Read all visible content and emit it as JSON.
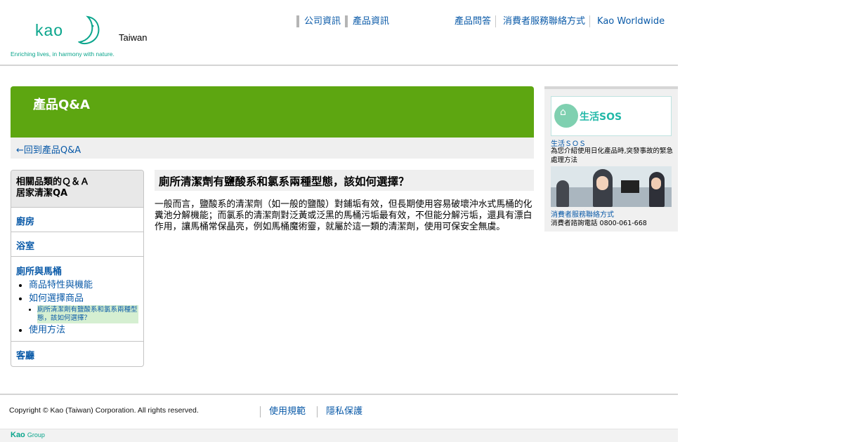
{
  "header": {
    "logo_text": "kao",
    "tagline": "Enriching lives, in harmony with nature.",
    "region": "Taiwan",
    "nav_primary": [
      "公司資訊",
      "產品資訊"
    ],
    "nav_secondary": [
      "產品問答",
      "消費者服務聯絡方式",
      "Kao Worldwide"
    ]
  },
  "banner": {
    "title": "產品Q&A",
    "back_link": "←回到產品Q&A"
  },
  "menu": {
    "heading_line1": "相關品類的Ｑ＆Ａ",
    "heading_line2": "居家清潔QA",
    "sections": [
      {
        "label": "廚房"
      },
      {
        "label": "浴室"
      },
      {
        "label": "廁所與馬桶",
        "items": [
          "商品特性與機能",
          "如何選擇商品",
          "使用方法"
        ],
        "sub_items": [
          "廁所清潔劑有鹽酸系和氯系兩種型態，該如何選擇？"
        ]
      },
      {
        "label": "客廳"
      }
    ]
  },
  "main": {
    "question": "廁所清潔劑有鹽酸系和氯系兩種型態，該如何選擇？",
    "answer": "一般而言，鹽酸系的清潔劑（如一般的鹽酸）對鋪垢有效，但長期使用容易破壞沖水式馬桶的化糞池分解機能；而氯系的清潔劑對泛黃或泛黑的馬桶污垢最有效，不但能分解污垢，還具有漂白作用，讓馬桶常保晶亮，例如馬桶魔術靈，就屬於這一類的清潔劑，使用可保安全無虞。"
  },
  "side": {
    "sos_banner": "生活SOS",
    "sos_link": "生活ＳＯＳ",
    "sos_desc": "為您介紹使用日化產品時,突發事故的緊急處理方法",
    "contact_link": "消費者服務聯絡方式",
    "contact_desc": "消費者諮詢電話 0800-061-668"
  },
  "footer": {
    "copyright": "Copyright © Kao (Taiwan) Corporation. All rights reserved.",
    "links": [
      "使用規範",
      "隱私保護"
    ],
    "group_logo": "Kao",
    "group_label": "Group"
  },
  "colors": {
    "brand": "#0aa58c",
    "banner_green": "#5da611",
    "link": "#0a5aa8",
    "highlight": "#d5efd1"
  }
}
